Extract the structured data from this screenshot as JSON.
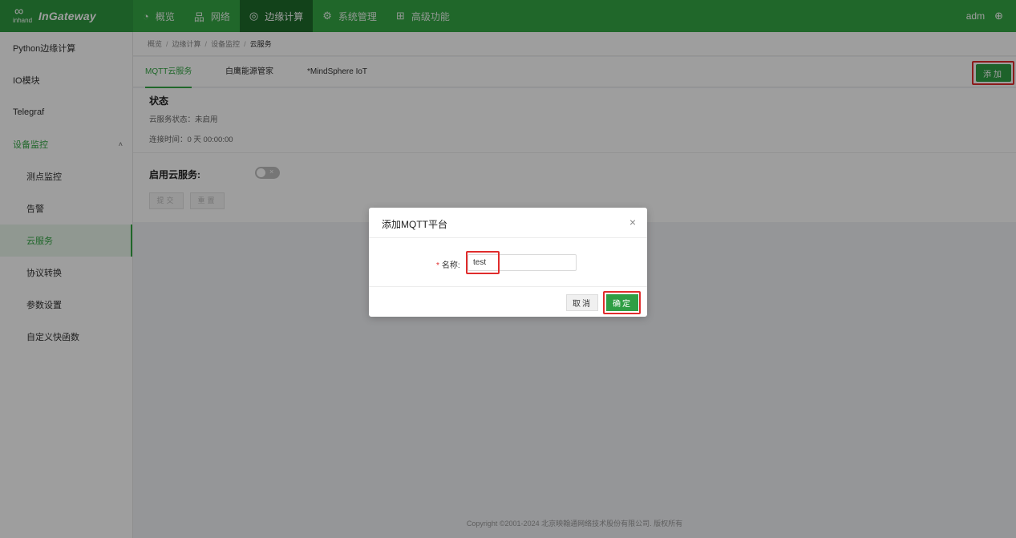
{
  "header": {
    "logo_top": "∞",
    "logo_brand_small": "inhand",
    "logo_text": "InGateway",
    "nav": [
      {
        "icon": "◔",
        "label": "概览"
      },
      {
        "icon": "品",
        "label": "网络"
      },
      {
        "icon": "◎",
        "label": "边缘计算",
        "active": true
      },
      {
        "icon": "⚙",
        "label": "系统管理"
      },
      {
        "icon": "⊞",
        "label": "高级功能"
      }
    ],
    "user": "adm",
    "globe_icon": "⊕"
  },
  "sidebar": {
    "items": [
      {
        "label": "Python边缘计算"
      },
      {
        "label": "IO模块"
      },
      {
        "label": "Telegraf"
      },
      {
        "label": "设备监控",
        "expanded": true,
        "caret": "˄"
      },
      {
        "label": "测点监控"
      },
      {
        "label": "告警"
      },
      {
        "label": "云服务",
        "active": true
      },
      {
        "label": "协议转换"
      },
      {
        "label": "参数设置"
      },
      {
        "label": "自定义快函数"
      }
    ]
  },
  "breadcrumb": [
    "概览",
    "边缘计算",
    "设备监控",
    "云服务"
  ],
  "breadcrumb_sep": "/",
  "tabs": [
    "MQTT云服务",
    "白鹰能源管家",
    "*MindSphere IoT"
  ],
  "add_button": "添加",
  "status": {
    "title": "状态",
    "cloud_status": "云服务状态：未启用",
    "connect_time": "连接时间：0 天 00:00:00"
  },
  "enable": {
    "label": "启用云服务:",
    "toggle_mark": "×",
    "submit": "提交",
    "reset": "重置"
  },
  "footer": "Copyright ©2001-2024 北京映翰通网络技术股份有限公司. 版权所有",
  "modal": {
    "title": "添加MQTT平台",
    "close": "×",
    "required_mark": "*",
    "name_label": "名称:",
    "name_value": "test",
    "cancel": "取消",
    "ok": "确定"
  },
  "colors": {
    "brand": "#34a745",
    "nav_active": "#1d6b2b",
    "highlight": "#e02c2c"
  }
}
